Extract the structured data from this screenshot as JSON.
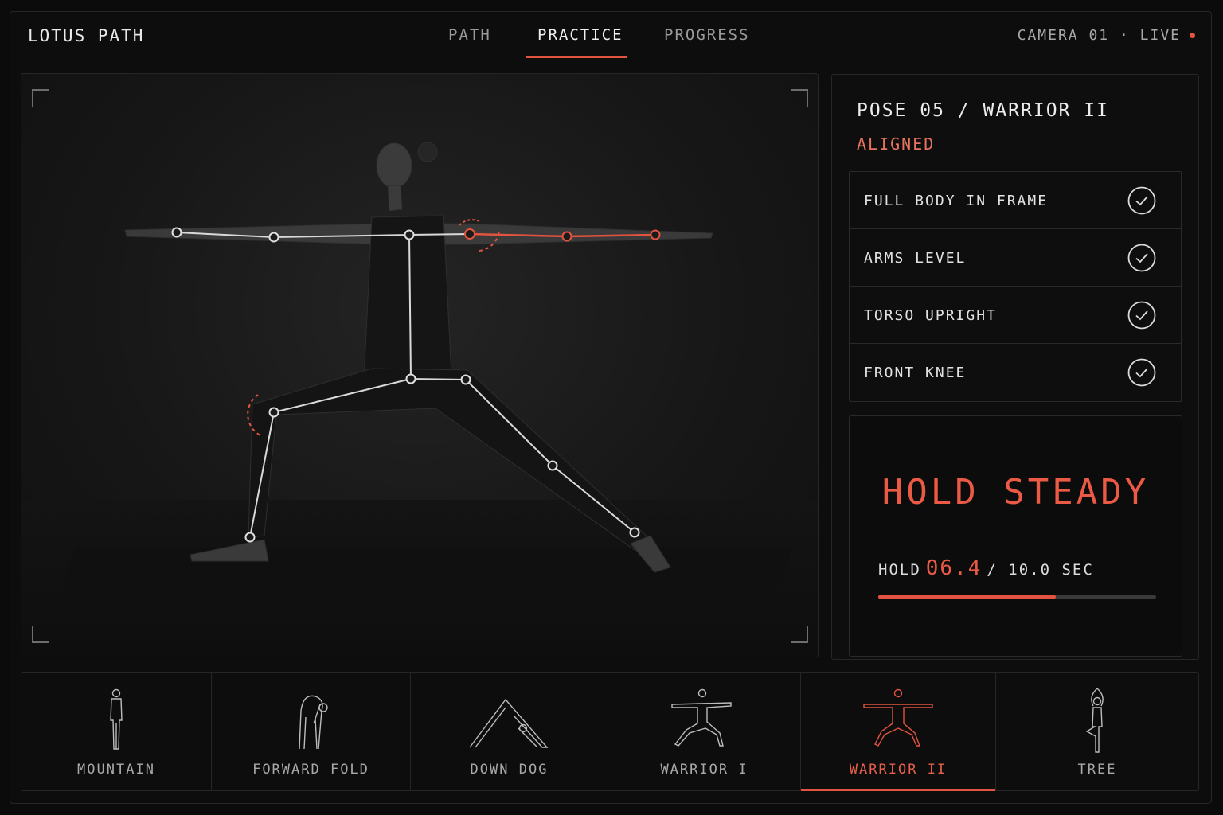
{
  "app": {
    "title": "LOTUS PATH"
  },
  "nav": {
    "tabs": [
      "PATH",
      "PRACTICE",
      "PROGRESS"
    ],
    "active_tab": "PRACTICE"
  },
  "camera": {
    "label": "CAMERA 01 · LIVE",
    "live": true
  },
  "pose": {
    "title": "POSE 05 / WARRIOR II",
    "status": "ALIGNED"
  },
  "checks": [
    {
      "label": "FULL BODY IN FRAME",
      "passed": true
    },
    {
      "label": "ARMS LEVEL",
      "passed": true
    },
    {
      "label": "TORSO UPRIGHT",
      "passed": true
    },
    {
      "label": "FRONT KNEE",
      "passed": true
    }
  ],
  "hold": {
    "heading": "HOLD STEADY",
    "prefix": "HOLD",
    "current": "06.4",
    "target": "/ 10.0 SEC",
    "progress": 0.64
  },
  "pose_library": [
    {
      "label": "MOUNTAIN",
      "icon": "mountain-pose-icon",
      "active": false
    },
    {
      "label": "FORWARD FOLD",
      "icon": "forward-fold-pose-icon",
      "active": false
    },
    {
      "label": "DOWN DOG",
      "icon": "down-dog-pose-icon",
      "active": false
    },
    {
      "label": "WARRIOR I",
      "icon": "warrior-one-pose-icon",
      "active": false
    },
    {
      "label": "WARRIOR II",
      "icon": "warrior-two-pose-icon",
      "active": true
    },
    {
      "label": "TREE",
      "icon": "tree-pose-icon",
      "active": false
    }
  ],
  "colors": {
    "accent": "#e2543f",
    "background": "#0b0b0b",
    "border": "#262626",
    "text": "#e6e6e6",
    "muted": "#9a9a9a"
  }
}
